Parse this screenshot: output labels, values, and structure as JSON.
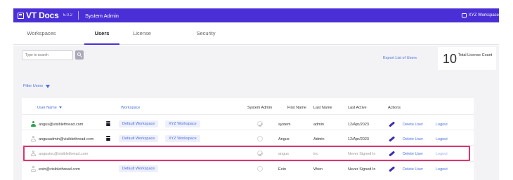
{
  "header": {
    "app_name": "VT Docs",
    "version": "5.0.2",
    "section": "System Admin",
    "workspace": "XYZ Workspace"
  },
  "tabs": [
    {
      "label": "Workspaces",
      "active": false
    },
    {
      "label": "Users",
      "active": true
    },
    {
      "label": "License",
      "active": false
    },
    {
      "label": "Security",
      "active": false
    }
  ],
  "search": {
    "placeholder": "Type to search",
    "value": ""
  },
  "export_link": "Export List of Users",
  "license": {
    "count": "10",
    "label": "Total License Count"
  },
  "filter_label": "Filter Users",
  "table": {
    "columns": {
      "user_name": "User Name",
      "workspace": "Workspace",
      "system_admin": "System Admin",
      "first_name": "First Name",
      "last_name": "Last Name",
      "last_active": "Last Active",
      "actions": "Actions"
    },
    "rows": [
      {
        "email": "angus@visiblethread.com",
        "workspaces": [
          "Default Workspace",
          "XYZ Workspace"
        ],
        "system_admin": true,
        "first_name": "system",
        "last_name": "admin",
        "last_active": "12/Apr/2023",
        "delete": "Delete User",
        "logout": "Logout",
        "status": "active"
      },
      {
        "email": "angusadmin@visiblethread.com",
        "workspaces": [
          "Default Workspace",
          "XYZ Workspace"
        ],
        "system_admin": false,
        "first_name": "Angus",
        "last_name": "Admin",
        "last_active": "12/Apr/2023",
        "delete": "Delete User",
        "logout": "Logout",
        "status": "normal"
      },
      {
        "email": "angusinc@visiblethread.com",
        "workspaces": [],
        "system_admin": true,
        "first_name": "angus",
        "last_name": "inc",
        "last_active": "Never Signed In",
        "delete": "Delete User",
        "logout": "Logout",
        "status": "highlighted"
      },
      {
        "email": "eoin@visiblethread.com",
        "workspaces": [
          "Default Workspace"
        ],
        "system_admin": false,
        "first_name": "Eoin",
        "last_name": "Wren",
        "last_active": "Never Signed In",
        "delete": "Delete User",
        "logout": "Logout",
        "status": "normal"
      }
    ]
  },
  "colors": {
    "brand": "#4a2fd6",
    "link": "#4a6fe0",
    "highlight": "#e0336e",
    "active_user": "#2fa14f"
  }
}
